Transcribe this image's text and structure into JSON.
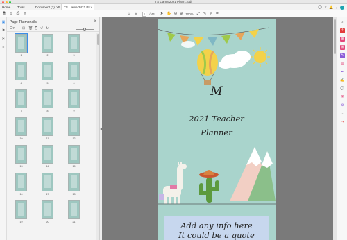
{
  "window": {
    "title": "TS Llama 2021 Plann...pdf"
  },
  "tabs": {
    "home": "Home",
    "tools": "Tools",
    "doc1": "Document (1).pdf",
    "doc2": "TS Llama 2021 Pl..."
  },
  "toolbar": {
    "page_current": "1",
    "page_total": "/ 44",
    "zoom": "100%"
  },
  "sidebar": {
    "title": "Page Thumbnails",
    "close": "×"
  },
  "thumb_labels": [
    "1",
    "2",
    "3",
    "4",
    "5",
    "6",
    "7",
    "8",
    "9",
    "10",
    "11",
    "12",
    "13",
    "14",
    "15",
    "16",
    "17",
    "18",
    "19",
    "20",
    "21"
  ],
  "page": {
    "title_initial": "M",
    "title_line1": "2021 Teacher",
    "title_line2": "Planner",
    "box_line1": "Add any info here",
    "box_line2": "It could be a quote"
  },
  "colors": {
    "page_bg": "#a9d4cc",
    "box_bg": "#c7d7ee",
    "accent": "#3b8ee8"
  }
}
